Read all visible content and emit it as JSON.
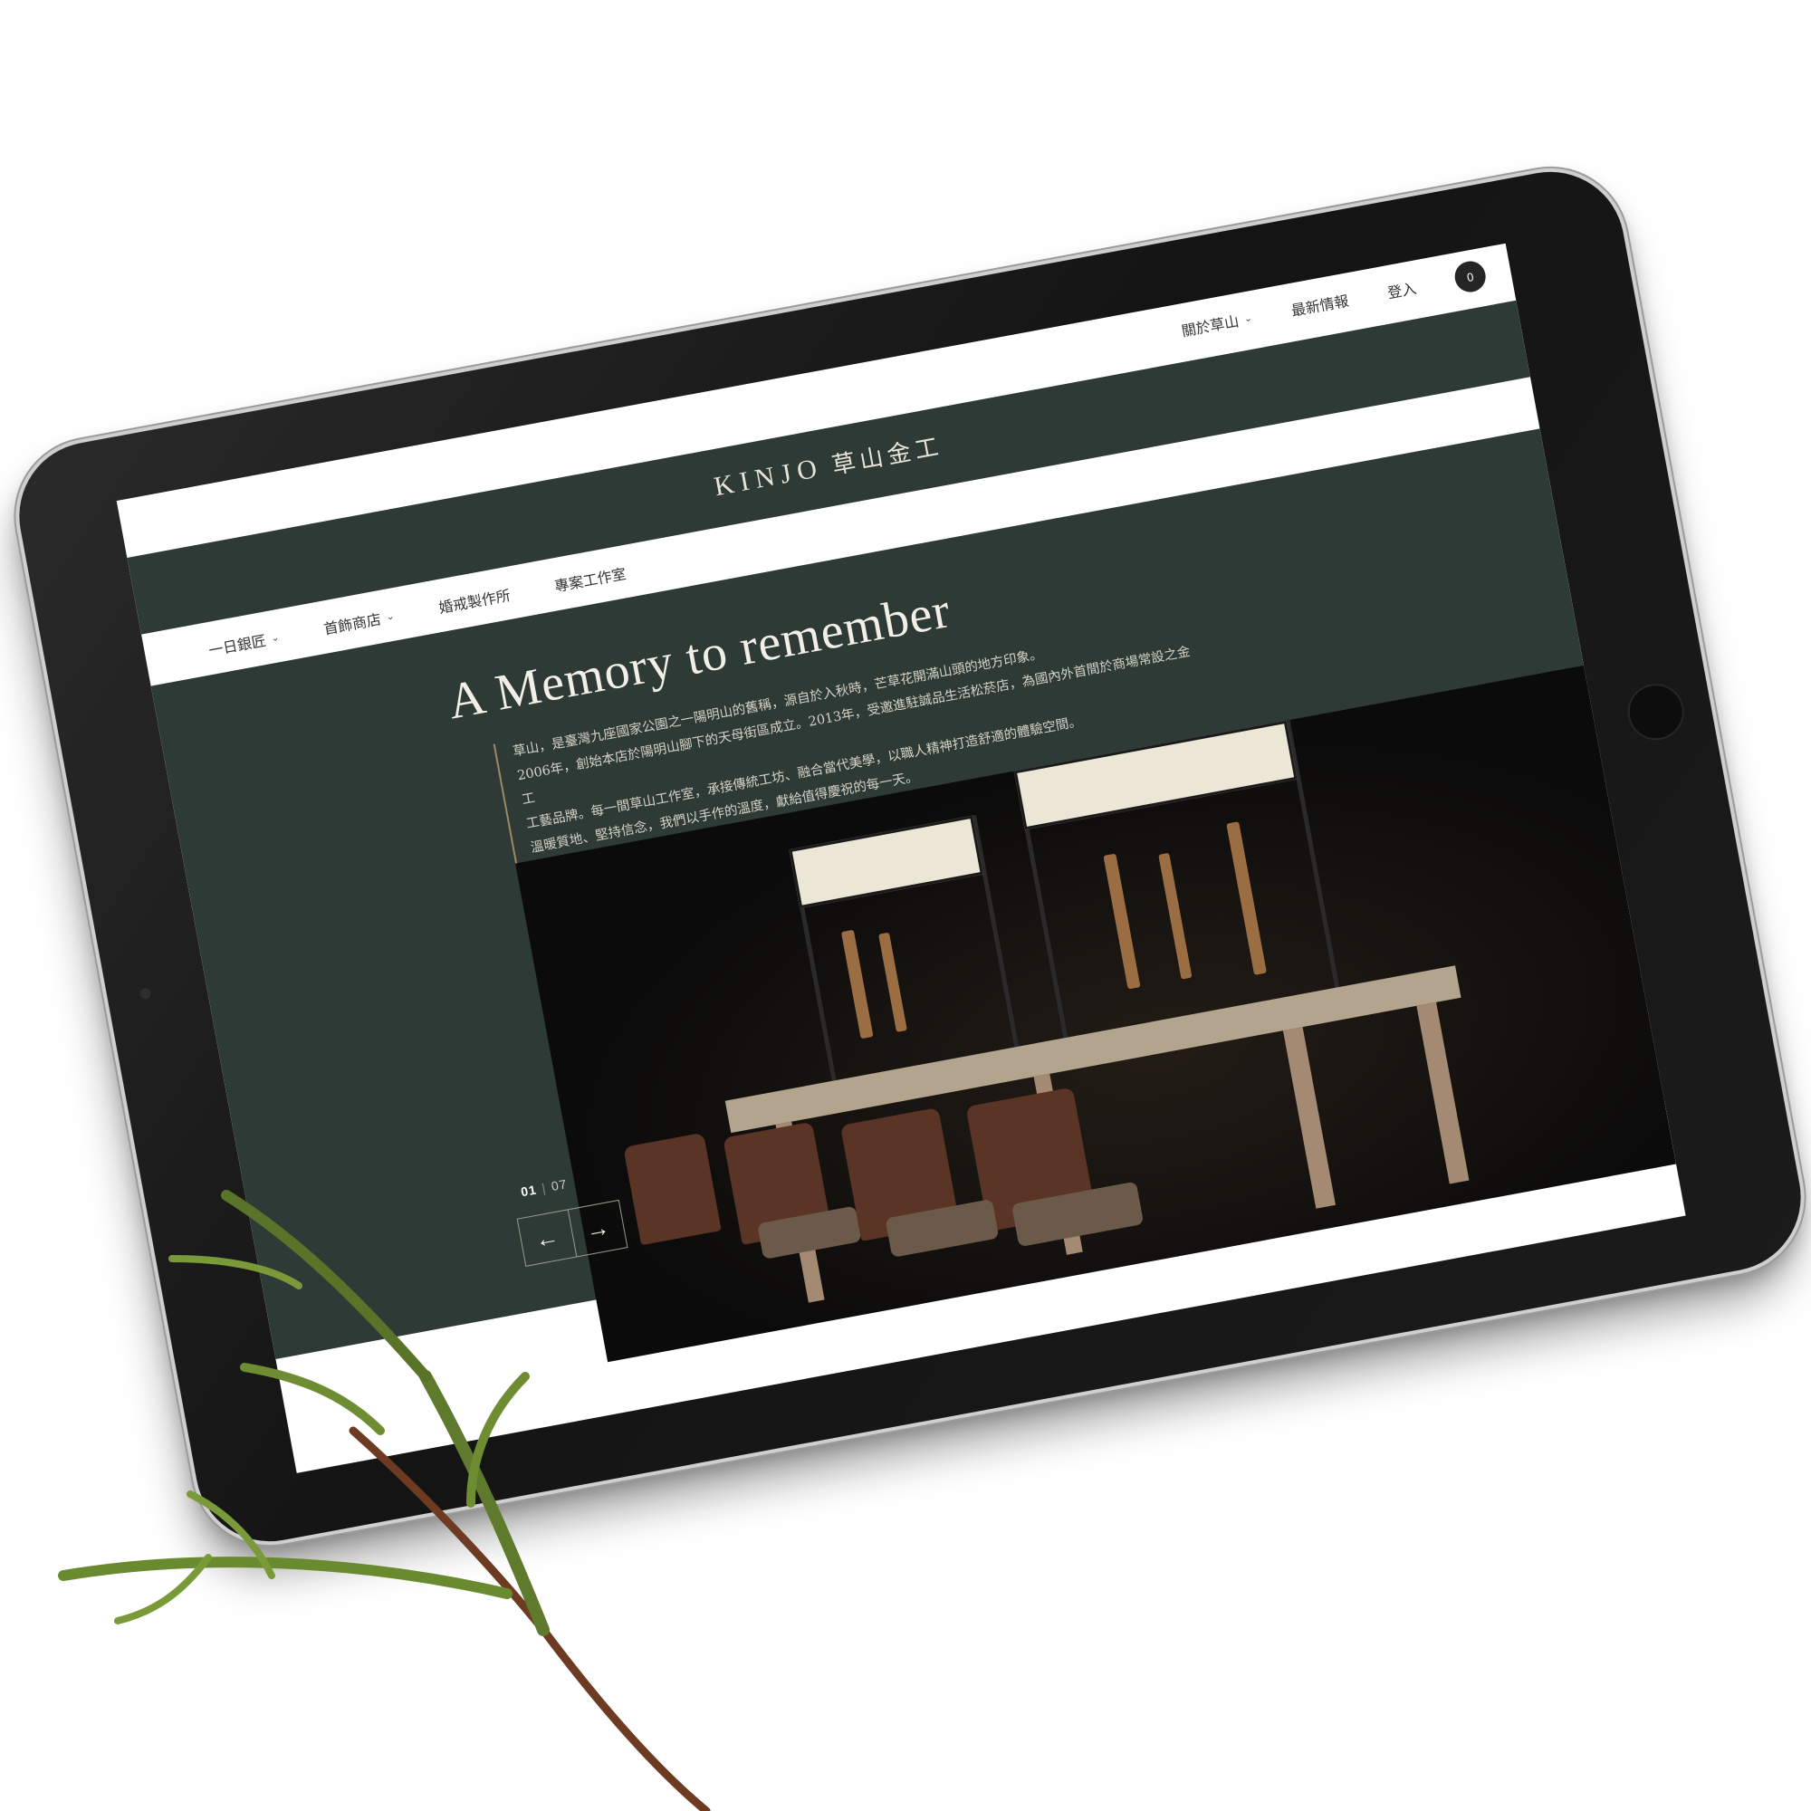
{
  "topbar": {
    "about_label": "關於草山",
    "news_label": "最新情報",
    "login_label": "登入",
    "cart_count": "0"
  },
  "brand": {
    "logo_text": "KINJO",
    "logo_cn": "草山金工"
  },
  "nav": {
    "items": [
      {
        "label": "一日銀匠",
        "has_dropdown": true
      },
      {
        "label": "首飾商店",
        "has_dropdown": true
      },
      {
        "label": "婚戒製作所",
        "has_dropdown": false
      },
      {
        "label": "專案工作室",
        "has_dropdown": false
      }
    ]
  },
  "hero": {
    "headline": "A Memory to remember",
    "intro_lines": [
      "草山，是臺灣九座國家公園之一陽明山的舊稱，源自於入秋時，芒草花開滿山頭的地方印象。",
      "2006年，創始本店於陽明山腳下的天母街區成立。2013年，受邀進駐誠品生活松菸店，為國內外首間於商場常設之金工",
      "工藝品牌。每一間草山工作室，承接傳統工坊、融合當代美學，以職人精神打造舒適的體驗空間。",
      "溫暖質地、堅持信念，我們以手作的溫度，獻給值得慶祝的每一天。"
    ],
    "slide_current": "01",
    "slide_total": "07",
    "prev_arrow": "←",
    "next_arrow": "→"
  },
  "colors": {
    "hero_bg": "#2e3a36",
    "accent_line": "#9c8a63",
    "cart_badge": "#252525"
  }
}
